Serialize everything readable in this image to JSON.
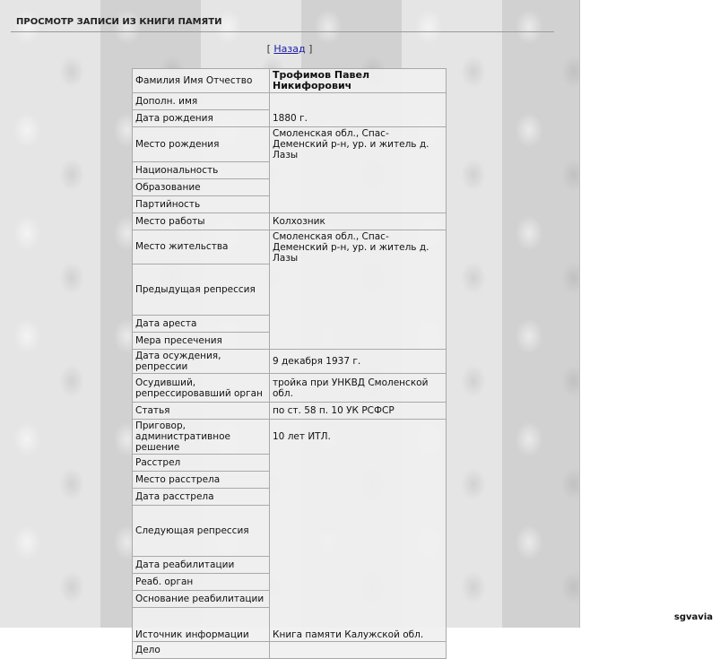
{
  "header": {
    "title": "ПРОСМОТР ЗАПИСИ ИЗ КНИГИ ПАМЯТИ"
  },
  "nav": {
    "back_open": "[",
    "back_label": "Назад",
    "back_close": "]"
  },
  "record": {
    "rows": [
      {
        "label": "Фамилия Имя Отчество",
        "value": "Трофимов Павел Никифорович"
      },
      {
        "label": "Дополн. имя",
        "value": ""
      },
      {
        "label": "Дата рождения",
        "value": "1880 г."
      },
      {
        "label": "Место рождения",
        "value": "Смоленская обл., Спас-Деменский р-н, ур. и житель д. Лазы"
      },
      {
        "label": "Национальность",
        "value": ""
      },
      {
        "label": "Образование",
        "value": ""
      },
      {
        "label": "Партийность",
        "value": ""
      },
      {
        "label": "Место работы",
        "value": "Колхозник"
      },
      {
        "label": "Место жительства",
        "value": "Смоленская обл., Спас-Деменский р-н, ур. и житель д. Лазы"
      },
      {
        "label": "Предыдущая репрессия",
        "value": ""
      },
      {
        "label": "Дата ареста",
        "value": ""
      },
      {
        "label": "Мера пресечения",
        "value": ""
      },
      {
        "label": "Дата осуждения, репрессии",
        "value": "9 декабря 1937 г."
      },
      {
        "label": "Осудивший, репрессировавший орган",
        "value": "тройка при УНКВД Смоленской обл."
      },
      {
        "label": "Статья",
        "value": "по ст. 58 п. 10 УК РСФСР"
      },
      {
        "label": "Приговор, административное решение",
        "value": "10 лет ИТЛ."
      },
      {
        "label": "Расстрел",
        "value": ""
      },
      {
        "label": "Место расстрела",
        "value": ""
      },
      {
        "label": "Дата расстрела",
        "value": ""
      },
      {
        "label": "Следующая репрессия",
        "value": ""
      },
      {
        "label": "Дата реабилитации",
        "value": ""
      },
      {
        "label": "Реаб. орган",
        "value": ""
      },
      {
        "label": "Основание реабилитации",
        "value": ""
      },
      {
        "label": "Источник информации",
        "value": "Книга памяти Калужской обл."
      },
      {
        "label": "Дело",
        "value": ""
      }
    ]
  },
  "watermark": "sgvavia"
}
